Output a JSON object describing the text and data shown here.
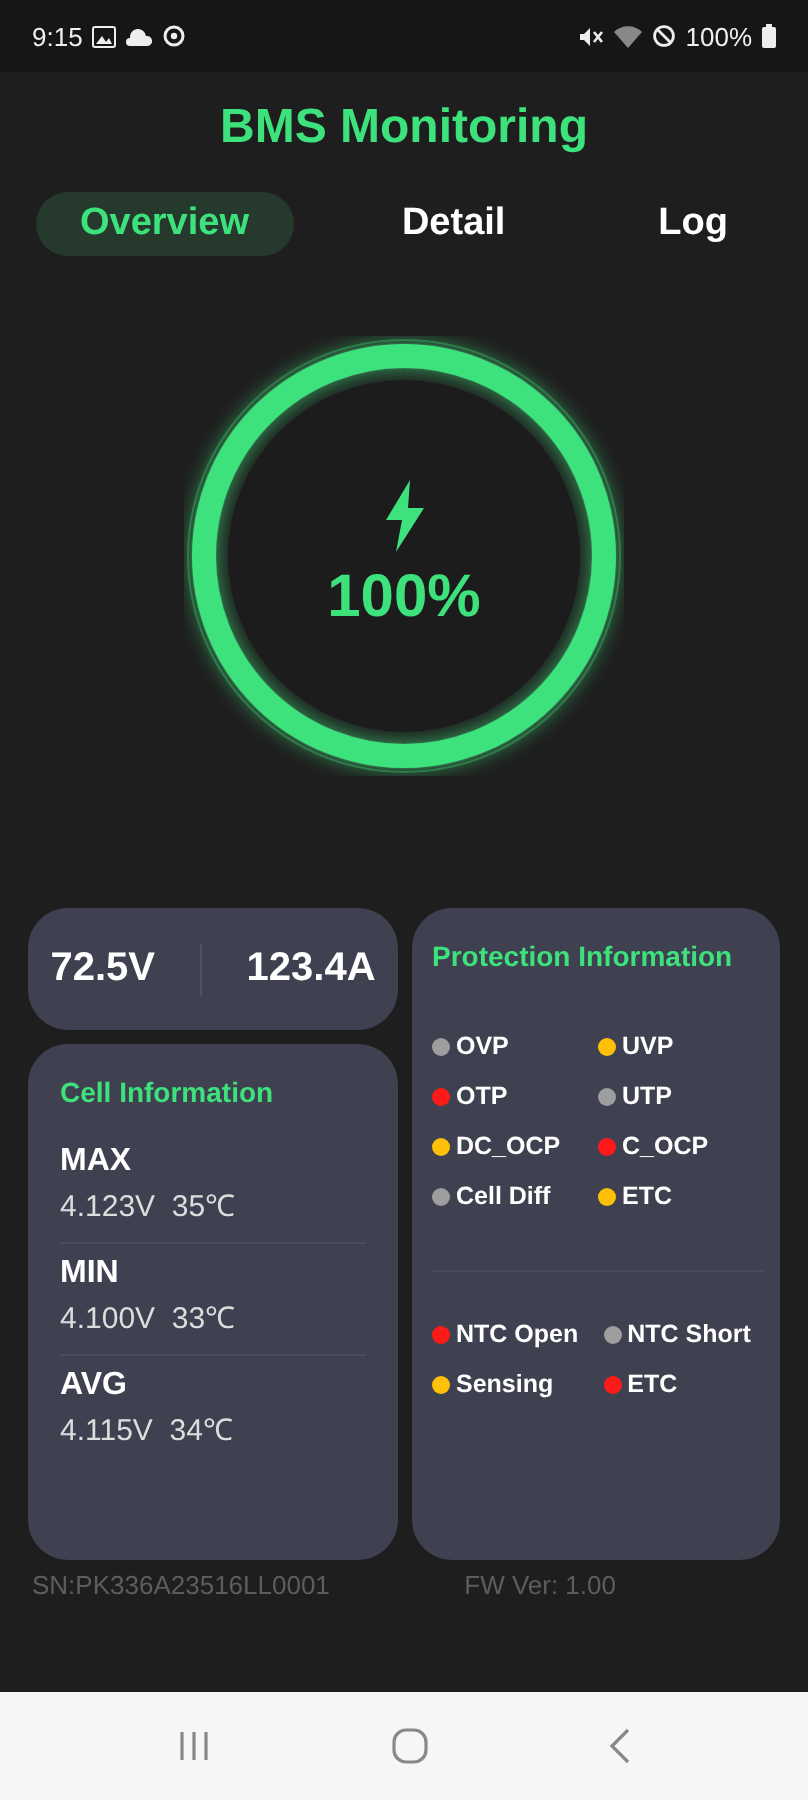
{
  "status_bar": {
    "time": "9:15",
    "battery": "100%"
  },
  "title": "BMS Monitoring",
  "tabs": [
    {
      "label": "Overview",
      "selected": true
    },
    {
      "label": "Detail",
      "selected": false
    },
    {
      "label": "Log",
      "selected": false
    }
  ],
  "gauge": {
    "reading": "100%"
  },
  "readings": {
    "voltage": "72.5V",
    "current": "123.4A"
  },
  "cell_information": {
    "title": "Cell Information",
    "rows": [
      {
        "label": "MAX",
        "voltage": "4.123V",
        "temperature": "35℃"
      },
      {
        "label": "MIN",
        "voltage": "4.100V",
        "temperature": "33℃"
      },
      {
        "label": "AVG",
        "voltage": "4.115V",
        "temperature": "34℃"
      }
    ]
  },
  "protection_information": {
    "title": "Protection Information",
    "groups": [
      [
        {
          "label": "OVP",
          "color": "#9e9e9e"
        },
        {
          "label": "UVP",
          "color": "#ffc107"
        },
        {
          "label": "OTP",
          "color": "#ff1a1a"
        },
        {
          "label": "UTP",
          "color": "#9e9e9e"
        },
        {
          "label": "DC_OCP",
          "color": "#ffc107"
        },
        {
          "label": "C_OCP",
          "color": "#ff1a1a"
        },
        {
          "label": "Cell Diff",
          "color": "#9e9e9e"
        },
        {
          "label": "ETC",
          "color": "#ffc107"
        }
      ],
      [
        {
          "label": "NTC Open",
          "color": "#ff1a1a"
        },
        {
          "label": "NTC Short",
          "color": "#9e9e9e"
        },
        {
          "label": "Sensing",
          "color": "#ffc107"
        },
        {
          "label": "ETC",
          "color": "#ff1a1a"
        }
      ]
    ]
  },
  "serial": "SN:PK336A23516LL0001",
  "firmware": "FW Ver: 1.00"
}
